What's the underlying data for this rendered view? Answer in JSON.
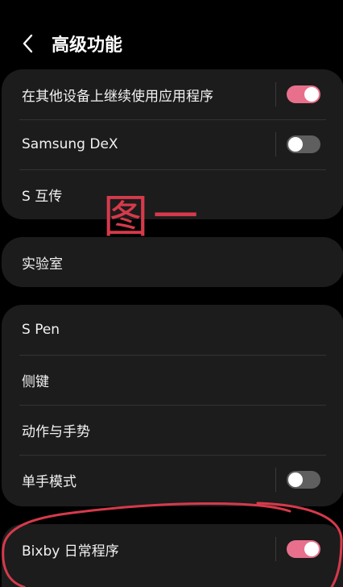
{
  "header": {
    "title": "高级功能",
    "back_icon": "chevron-left-icon"
  },
  "colors": {
    "background": "#000000",
    "card": "#1c1c1c",
    "toggle_on": "#e8708c",
    "toggle_off": "#5f5f5f",
    "annotation": "#d63a4b"
  },
  "group1": {
    "continue_apps_label": "在其他设备上继续使用应用程序",
    "continue_apps_on": true,
    "dex_label": "Samsung DeX",
    "dex_on": false,
    "share_label": "S 互传"
  },
  "group2": {
    "labs_label": "实验室"
  },
  "group3": {
    "spen_label": "S Pen",
    "side_key_label": "侧键",
    "motions_label": "动作与手势",
    "one_hand_label": "单手模式",
    "one_hand_on": false
  },
  "group4": {
    "bixby_label": "Bixby 日常程序",
    "bixby_on": true
  },
  "annotation": {
    "text": "图一"
  }
}
